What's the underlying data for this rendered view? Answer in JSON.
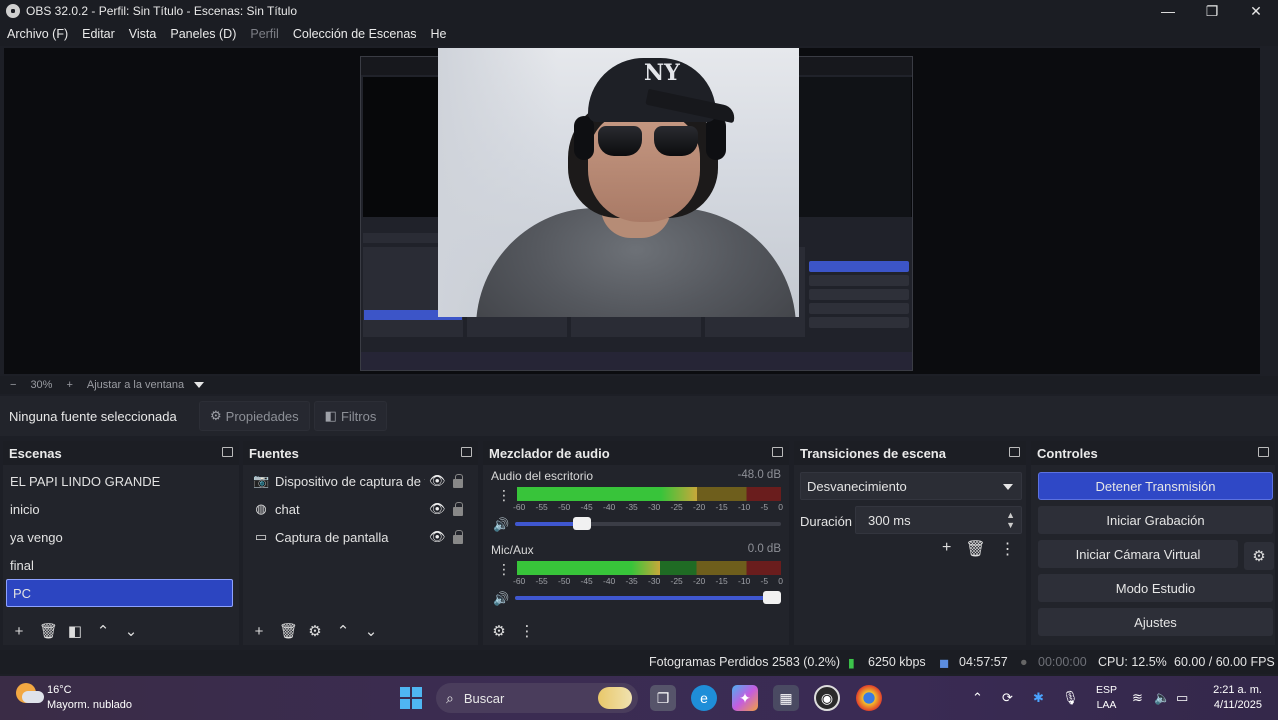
{
  "window": {
    "title": "OBS 32.0.2 - Perfil: Sin Título - Escenas: Sin Título",
    "minimize": "—",
    "maximize": "❐",
    "close": "✕"
  },
  "menu": [
    "Archivo (F)",
    "Editar",
    "Vista",
    "Paneles (D)",
    "Perfil",
    "Colección de Escenas",
    "He"
  ],
  "zoom": {
    "minus": "−",
    "value": "30%",
    "plus": "+",
    "fit": "Ajustar a la ventana"
  },
  "source_toolbar": {
    "no_source": "Ninguna fuente seleccionada",
    "properties": "Propiedades",
    "filters": "Filtros"
  },
  "scenes": {
    "title": "Escenas",
    "items": [
      "EL PAPI LINDO GRANDE",
      "inicio",
      "ya vengo",
      "final",
      "PC"
    ],
    "selected_index": 4
  },
  "sources": {
    "title": "Fuentes",
    "items": [
      {
        "label": "Dispositivo de captura de video",
        "icon": "camera-icon"
      },
      {
        "label": "chat",
        "icon": "globe-icon"
      },
      {
        "label": "Captura de pantalla",
        "icon": "monitor-icon"
      }
    ]
  },
  "mixer": {
    "title": "Mezclador de audio",
    "channels": [
      {
        "name": "Audio del escritorio",
        "db": "-48.0 dB",
        "level": 0.68,
        "volume": 0.25
      },
      {
        "name": "Mic/Aux",
        "db": "0.0 dB",
        "level": 0.54,
        "volume": 1.0
      }
    ],
    "ticks": [
      "-60",
      "-55",
      "-50",
      "-45",
      "-40",
      "-35",
      "-30",
      "-25",
      "-20",
      "-15",
      "-10",
      "-5",
      "0"
    ]
  },
  "transitions": {
    "title": "Transiciones de escena",
    "selected": "Desvanecimiento",
    "duration_label": "Duración",
    "duration_value": "300 ms"
  },
  "controls": {
    "title": "Controles",
    "stop_stream": "Detener Transmisión",
    "start_recording": "Iniciar Grabación",
    "start_virtual_cam": "Iniciar Cámara Virtual",
    "studio_mode": "Modo Estudio",
    "settings": "Ajustes"
  },
  "status": {
    "dropped_frames": "Fotogramas Perdidos 2583 (0.2%)",
    "bitrate": "6250 kbps",
    "stream_time": "04:57:57",
    "record_time": "00:00:00",
    "cpu": "CPU: 12.5%",
    "fps": "60.00 / 60.00 FPS"
  },
  "taskbar": {
    "temp": "16°C",
    "condition": "Mayorm. nublado",
    "search_placeholder": "Buscar",
    "lang1": "ESP",
    "lang2": "LAA",
    "time": "2:21 a. m.",
    "date": "4/11/2025"
  },
  "colors": {
    "accent": "#2f48c6",
    "meter_green": "#38c43a",
    "meter_yellow": "#c8a83a",
    "meter_red": "#6a1d1d"
  }
}
